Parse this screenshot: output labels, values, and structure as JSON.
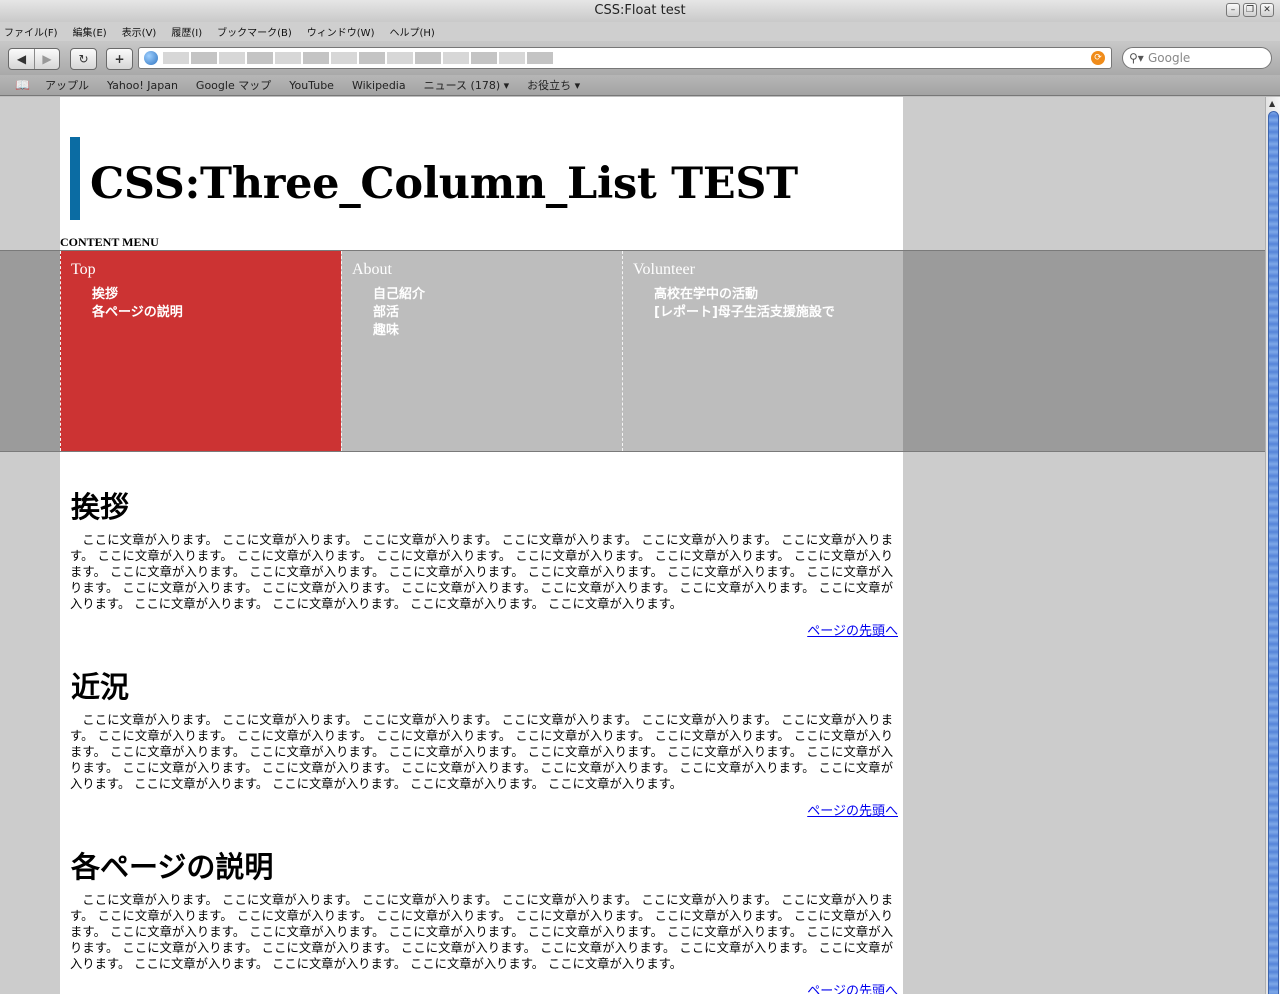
{
  "window": {
    "title": "CSS:Float test"
  },
  "menu": [
    "ファイル(F)",
    "編集(E)",
    "表示(V)",
    "履歴(I)",
    "ブックマーク(B)",
    "ウィンドウ(W)",
    "ヘルプ(H)"
  ],
  "toolbar": {
    "back": "◀",
    "forward": "▶",
    "reload": "↻",
    "new_tab": "+"
  },
  "search": {
    "placeholder": "Google"
  },
  "bookmarks": [
    "アップル",
    "Yahoo! Japan",
    "Google マップ",
    "YouTube",
    "Wikipedia",
    "ニュース (178) ▾",
    "お役立ち ▾"
  ],
  "page": {
    "title": "CSS:Three_Column_List TEST",
    "content_menu_label": "CONTENT MENU",
    "nav": [
      {
        "title": "Top",
        "links": [
          "挨拶",
          "各ページの説明"
        ]
      },
      {
        "title": "About",
        "links": [
          "自己紹介",
          "部活",
          "趣味"
        ]
      },
      {
        "title": "Volunteer",
        "links": [
          "高校在学中の活動",
          "[レポート]母子生活支援施設で"
        ]
      }
    ],
    "sections": [
      {
        "heading": "挨拶",
        "text": "ここに文章が入ります。 ここに文章が入ります。 ここに文章が入ります。 ここに文章が入ります。 ここに文章が入ります。 ここに文章が入ります。 ここに文章が入ります。 ここに文章が入ります。 ここに文章が入ります。 ここに文章が入ります。 ここに文章が入ります。 ここに文章が入ります。 ここに文章が入ります。 ここに文章が入ります。 ここに文章が入ります。 ここに文章が入ります。 ここに文章が入ります。 ここに文章が入ります。 ここに文章が入ります。 ここに文章が入ります。 ここに文章が入ります。 ここに文章が入ります。 ここに文章が入ります。 ここに文章が入ります。 ここに文章が入ります。 ここに文章が入ります。 ここに文章が入ります。 ここに文章が入ります。",
        "to_top": "ページの先頭へ"
      },
      {
        "heading": "近況",
        "text": "ここに文章が入ります。 ここに文章が入ります。 ここに文章が入ります。 ここに文章が入ります。 ここに文章が入ります。 ここに文章が入ります。 ここに文章が入ります。 ここに文章が入ります。 ここに文章が入ります。 ここに文章が入ります。 ここに文章が入ります。 ここに文章が入ります。 ここに文章が入ります。 ここに文章が入ります。 ここに文章が入ります。 ここに文章が入ります。 ここに文章が入ります。 ここに文章が入ります。 ここに文章が入ります。 ここに文章が入ります。 ここに文章が入ります。 ここに文章が入ります。 ここに文章が入ります。 ここに文章が入ります。 ここに文章が入ります。 ここに文章が入ります。 ここに文章が入ります。 ここに文章が入ります。",
        "to_top": "ページの先頭へ"
      },
      {
        "heading": "各ページの説明",
        "text": "ここに文章が入ります。 ここに文章が入ります。 ここに文章が入ります。 ここに文章が入ります。 ここに文章が入ります。 ここに文章が入ります。 ここに文章が入ります。 ここに文章が入ります。 ここに文章が入ります。 ここに文章が入ります。 ここに文章が入ります。 ここに文章が入ります。 ここに文章が入ります。 ここに文章が入ります。 ここに文章が入ります。 ここに文章が入ります。 ここに文章が入ります。 ここに文章が入ります。 ここに文章が入ります。 ここに文章が入ります。 ここに文章が入ります。 ここに文章が入ります。 ここに文章が入ります。 ここに文章が入ります。 ここに文章が入ります。 ここに文章が入ります。 ここに文章が入ります。 ここに文章が入ります。",
        "to_top": "ページの先頭へ"
      }
    ]
  },
  "colors": {
    "accent": "#0b6ca3",
    "nav_active": "#cc3333",
    "nav_inactive": "#bdbdbd",
    "link": "#0000ee"
  }
}
